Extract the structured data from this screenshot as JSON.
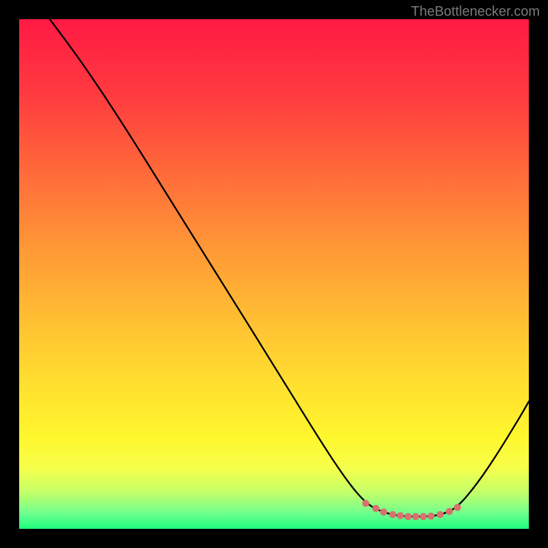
{
  "attribution": "TheBottlenecker.com",
  "gradient_stops": [
    {
      "offset": 0.0,
      "color": "#ff1a44"
    },
    {
      "offset": 0.15,
      "color": "#ff3b3f"
    },
    {
      "offset": 0.3,
      "color": "#ff6a3a"
    },
    {
      "offset": 0.45,
      "color": "#ff9836"
    },
    {
      "offset": 0.6,
      "color": "#ffc232"
    },
    {
      "offset": 0.72,
      "color": "#ffe02f"
    },
    {
      "offset": 0.82,
      "color": "#fff72d"
    },
    {
      "offset": 0.88,
      "color": "#f6ff4a"
    },
    {
      "offset": 0.93,
      "color": "#c2ff6a"
    },
    {
      "offset": 0.97,
      "color": "#6dff8e"
    },
    {
      "offset": 1.0,
      "color": "#1fff7f"
    }
  ],
  "chart_data": {
    "type": "line",
    "title": "",
    "xlabel": "",
    "ylabel": "",
    "xlim": [
      0,
      1
    ],
    "ylim": [
      0,
      1
    ],
    "series": [
      {
        "name": "bottleneck-curve",
        "points": [
          {
            "x": 0.06,
            "y": 1.0
          },
          {
            "x": 0.09,
            "y": 0.96
          },
          {
            "x": 0.13,
            "y": 0.905
          },
          {
            "x": 0.2,
            "y": 0.8
          },
          {
            "x": 0.3,
            "y": 0.64
          },
          {
            "x": 0.4,
            "y": 0.48
          },
          {
            "x": 0.5,
            "y": 0.32
          },
          {
            "x": 0.58,
            "y": 0.19
          },
          {
            "x": 0.64,
            "y": 0.098
          },
          {
            "x": 0.68,
            "y": 0.05
          },
          {
            "x": 0.71,
            "y": 0.034
          },
          {
            "x": 0.74,
            "y": 0.026
          },
          {
            "x": 0.77,
            "y": 0.024
          },
          {
            "x": 0.8,
            "y": 0.024
          },
          {
            "x": 0.83,
            "y": 0.028
          },
          {
            "x": 0.86,
            "y": 0.042
          },
          {
            "x": 0.9,
            "y": 0.09
          },
          {
            "x": 0.94,
            "y": 0.15
          },
          {
            "x": 0.98,
            "y": 0.215
          },
          {
            "x": 1.0,
            "y": 0.25
          }
        ]
      },
      {
        "name": "highlight-dots",
        "color": "#d9716e",
        "points": [
          {
            "x": 0.68,
            "y": 0.05
          },
          {
            "x": 0.7,
            "y": 0.04
          },
          {
            "x": 0.715,
            "y": 0.033
          },
          {
            "x": 0.733,
            "y": 0.028
          },
          {
            "x": 0.748,
            "y": 0.026
          },
          {
            "x": 0.763,
            "y": 0.024
          },
          {
            "x": 0.778,
            "y": 0.024
          },
          {
            "x": 0.793,
            "y": 0.024
          },
          {
            "x": 0.808,
            "y": 0.025
          },
          {
            "x": 0.826,
            "y": 0.028
          },
          {
            "x": 0.844,
            "y": 0.034
          },
          {
            "x": 0.86,
            "y": 0.042
          }
        ]
      }
    ]
  }
}
